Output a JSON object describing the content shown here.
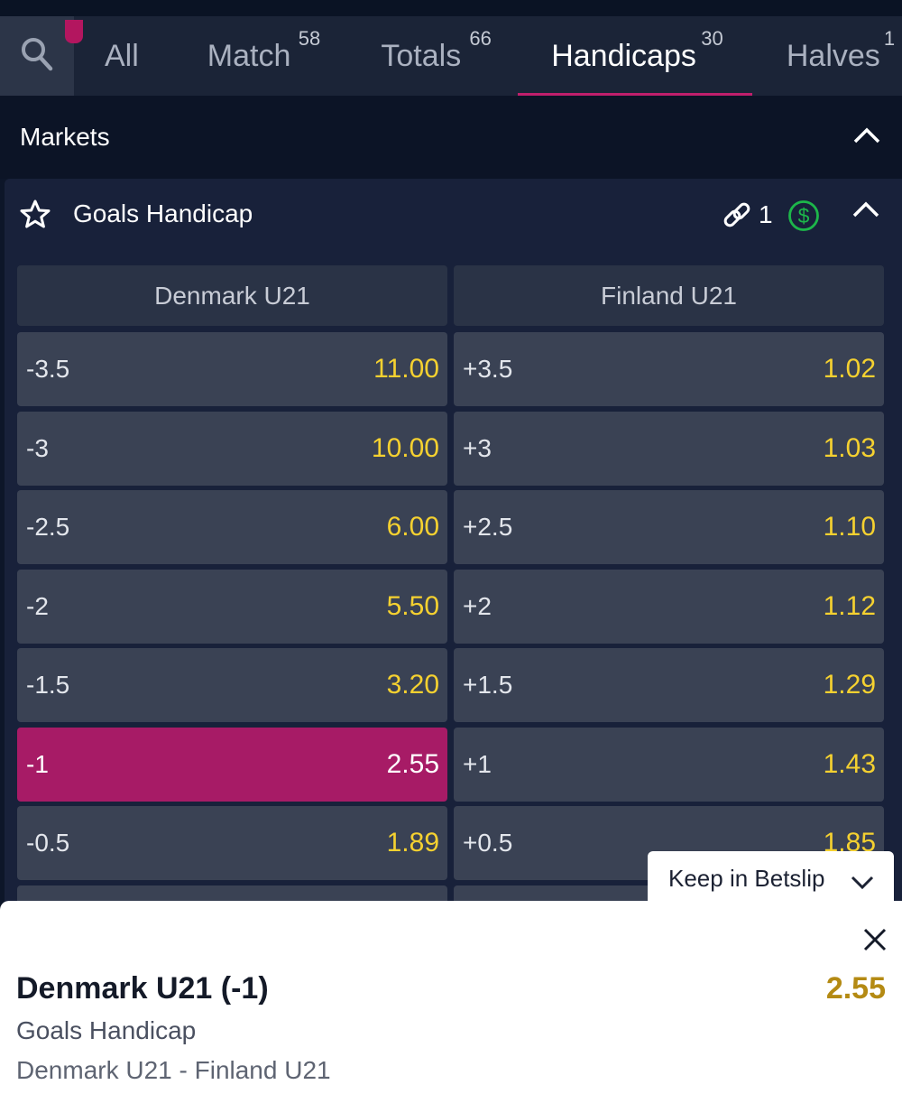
{
  "tabs": [
    {
      "label": "All",
      "count": ""
    },
    {
      "label": "Match",
      "count": "58"
    },
    {
      "label": "Totals",
      "count": "66"
    },
    {
      "label": "Handicaps",
      "count": "30"
    },
    {
      "label": "Halves",
      "count": "1"
    }
  ],
  "active_tab": "Handicaps",
  "markets_header": {
    "title": "Markets"
  },
  "market": {
    "title": "Goals Handicap",
    "linked_count": "1",
    "teams": [
      "Denmark U21",
      "Finland U21"
    ],
    "rows": [
      {
        "home_line": "-3.5",
        "home_odds": "11.00",
        "away_line": "+3.5",
        "away_odds": "1.02"
      },
      {
        "home_line": "-3",
        "home_odds": "10.00",
        "away_line": "+3",
        "away_odds": "1.03"
      },
      {
        "home_line": "-2.5",
        "home_odds": "6.00",
        "away_line": "+2.5",
        "away_odds": "1.10"
      },
      {
        "home_line": "-2",
        "home_odds": "5.50",
        "away_line": "+2",
        "away_odds": "1.12"
      },
      {
        "home_line": "-1.5",
        "home_odds": "3.20",
        "away_line": "+1.5",
        "away_odds": "1.29"
      },
      {
        "home_line": "-1",
        "home_odds": "2.55",
        "away_line": "+1",
        "away_odds": "1.43"
      },
      {
        "home_line": "-0.5",
        "home_odds": "1.89",
        "away_line": "+0.5",
        "away_odds": "1.85"
      }
    ],
    "selected_row": 5,
    "selected_side": "home"
  },
  "keep_in_betslip": {
    "label": "Keep in Betslip"
  },
  "betslip": {
    "selection": "Denmark U21 (-1)",
    "odds": "2.55",
    "market": "Goals Handicap",
    "event": "Denmark U21 - Finland U21"
  },
  "colors": {
    "background": "#0d1629",
    "accent": "#c01f6c",
    "selected_cell": "#a71b66",
    "odds_text": "#f5d130",
    "betslip_odds": "#b48a13",
    "cash_icon": "#1db64a"
  },
  "icons": [
    "search-icon",
    "star-icon",
    "link-icon",
    "dollar-icon",
    "chevron-up-icon",
    "chevron-down-icon",
    "close-icon"
  ]
}
